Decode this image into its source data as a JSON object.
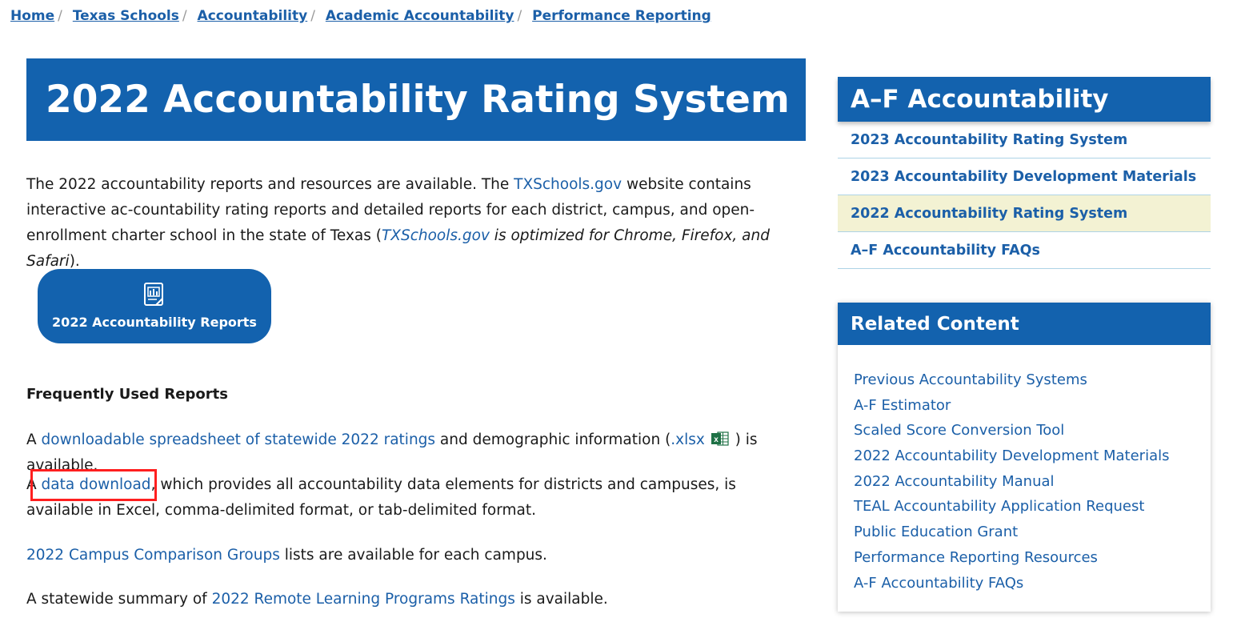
{
  "breadcrumb": {
    "items": [
      "Home",
      "Texas Schools",
      "Accountability",
      "Academic Accountability",
      "Performance Reporting"
    ],
    "separator": "/"
  },
  "page_title": "2022 Accountability Rating System",
  "intro": {
    "text1": "The 2022 accountability reports and resources are available. The ",
    "link1": "TXSchools.gov",
    "text2": " website contains interactive ac-countability rating reports and detailed reports for each district, campus, and open-enrollment charter school in the state of Texas (",
    "link2": "TXSchools.gov",
    "italic": " is optimized for Chrome, Firefox, and Safari",
    "text3": ")."
  },
  "reports_button": {
    "label": "2022 Accountability Reports",
    "icon": "report-document-icon"
  },
  "frequently_used": {
    "heading": "Frequently Used Reports",
    "p1": {
      "pre": "A ",
      "link": "downloadable spreadsheet of statewide 2022 ratings",
      "mid": " and demographic information (",
      "file_link": ".xlsx",
      "post": " )  is available.",
      "icon": "excel-file-icon"
    },
    "p2": {
      "pre": "A ",
      "link": "data download",
      "post": ", which provides all accountability data elements for districts and campuses, is available in Excel, comma-delimited format, or tab-delimited format."
    },
    "p3": {
      "link": "2022 Campus Comparison Groups",
      "post": " lists are available for each campus."
    },
    "p4": {
      "pre": "A statewide summary of ",
      "link": "2022 Remote Learning Programs Ratings",
      "post": " is available."
    }
  },
  "sidebar": {
    "title": "A–F Accountability",
    "items": [
      {
        "label": "2023 Accountability Rating System",
        "active": false
      },
      {
        "label": "2023 Accountability Development Materials",
        "active": false
      },
      {
        "label": "2022 Accountability Rating System",
        "active": true
      },
      {
        "label": "A–F Accountability FAQs",
        "active": false
      }
    ]
  },
  "related": {
    "title": "Related Content",
    "items": [
      "Previous Accountability Systems",
      "A-F Estimator",
      "Scaled Score Conversion Tool",
      "2022 Accountability Development Materials",
      "2022 Accountability Manual",
      "TEAL Accountability Application Request",
      "Public Education Grant",
      "Performance Reporting Resources",
      "A-F Accountability FAQs"
    ]
  },
  "colors": {
    "brand_blue": "#1362ae",
    "link_blue": "#1b5fa8",
    "active_bg": "#f3f2d3",
    "highlight_red": "#ff1f1f",
    "excel_green": "#1e7145"
  }
}
